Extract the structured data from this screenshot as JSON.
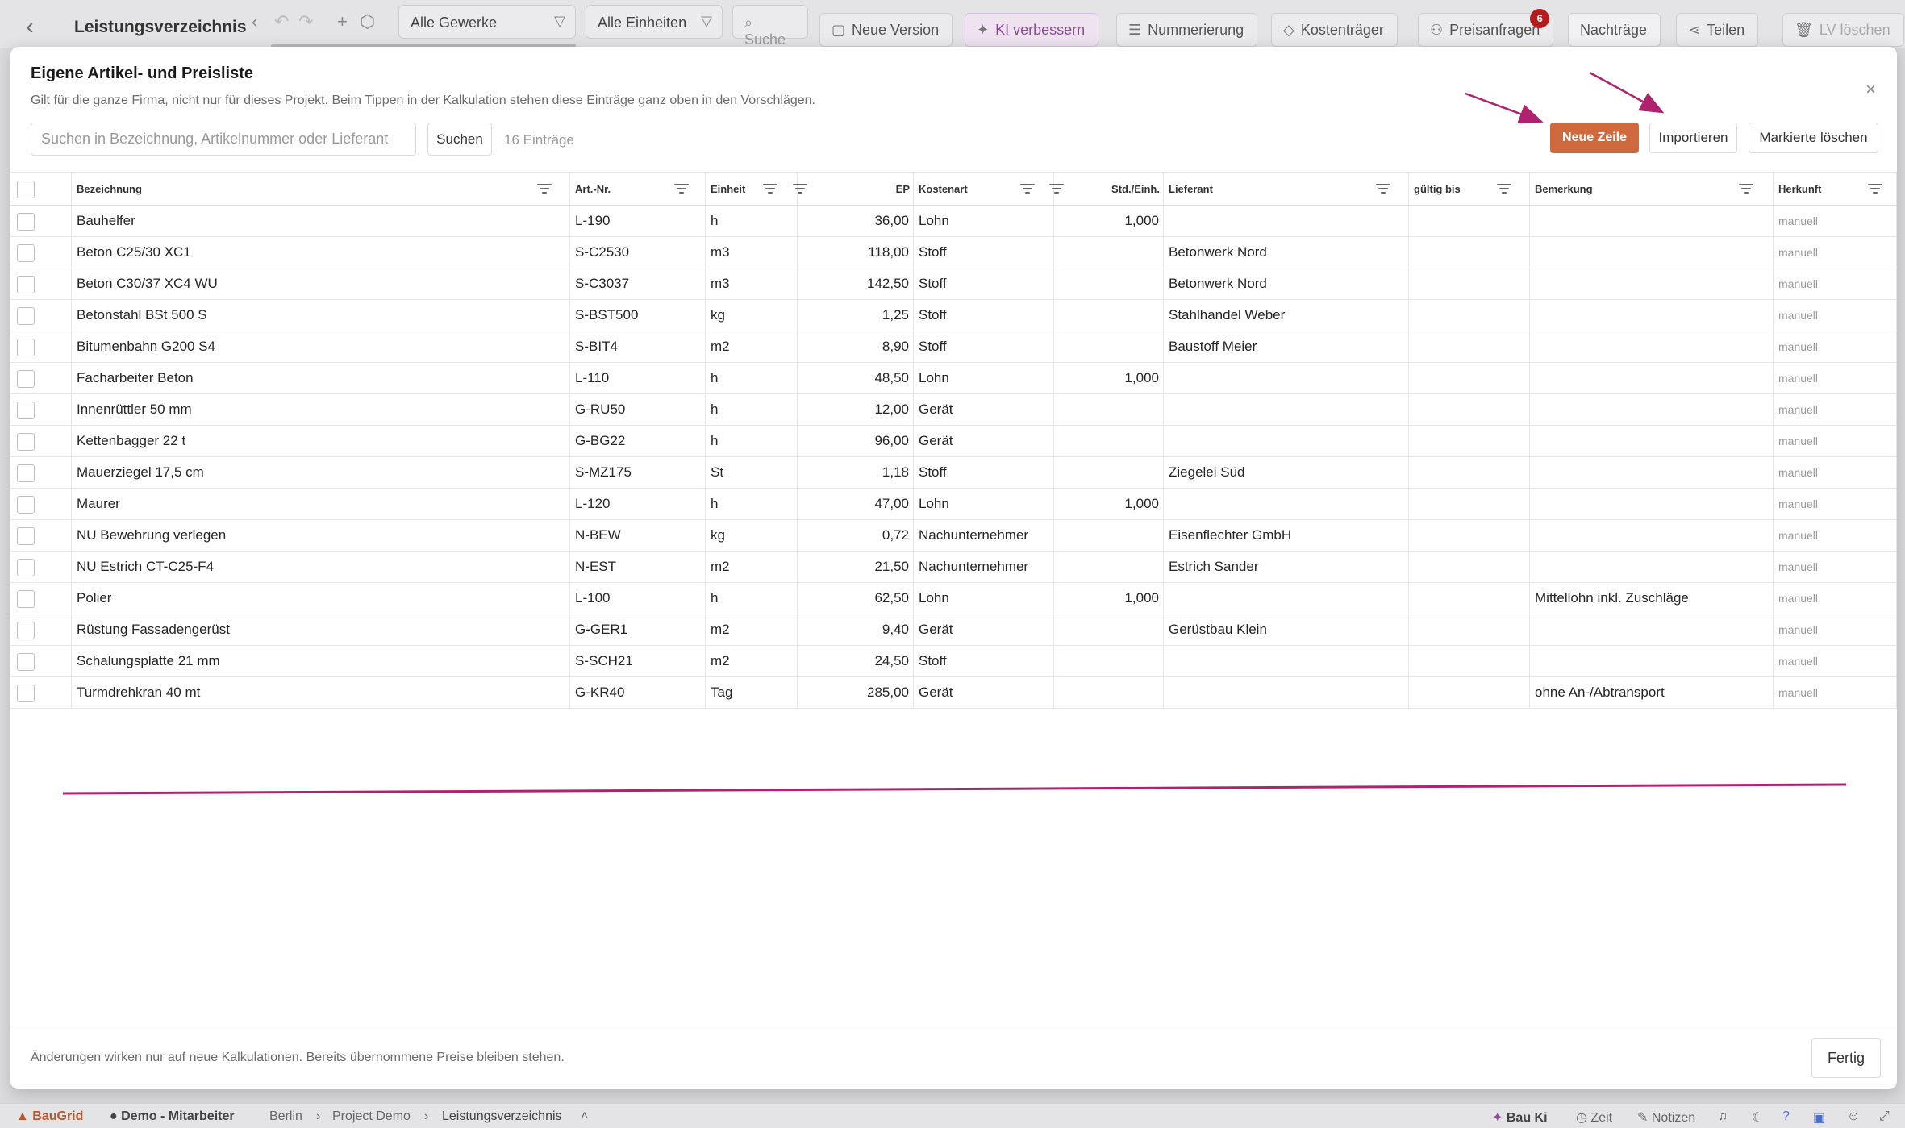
{
  "toolbar": {
    "title": "Leistungsverzeichnis",
    "trade_filter": "Alle Gewerke",
    "unit_filter": "Alle Einheiten",
    "search_placeholder": "Suche",
    "new_version": "Neue Version",
    "ki_improve": "KI verbessern",
    "numbering": "Nummerierung",
    "cost_bearer": "Kostenträger",
    "price_requests": "Preisanfragen",
    "price_requests_badge": "6",
    "supplements": "Nachträge",
    "share": "Teilen",
    "delete_lv": "LV löschen"
  },
  "modal": {
    "title": "Eigene Artikel- und Preisliste",
    "subtitle": "Gilt für die ganze Firma, nicht nur für dieses Projekt. Beim Tippen in der Kalkulation stehen diese Einträge ganz oben in den Vorschlägen.",
    "search_placeholder": "Suchen in Bezeichnung, Artikelnummer oder Lieferant",
    "search_button": "Suchen",
    "entry_count": "16 Einträge",
    "new_row": "Neue Zeile",
    "import": "Importieren",
    "delete_marked": "Markierte löschen",
    "close": "×",
    "footer_note": "Änderungen wirken nur auf neue Kalkulationen. Bereits übernommene Preise bleiben stehen.",
    "done": "Fertig"
  },
  "table": {
    "columns": [
      "Bezeichnung",
      "Art.-Nr.",
      "Einheit",
      "EP",
      "Kostenart",
      "Std./Einh.",
      "Lieferant",
      "gültig bis",
      "Bemerkung",
      "Herkunft"
    ],
    "rows": [
      [
        "Bauhelfer",
        "L-190",
        "h",
        "36,00",
        "Lohn",
        "1,000",
        "",
        "",
        "",
        "manuell"
      ],
      [
        "Beton C25/30 XC1",
        "S-C2530",
        "m3",
        "118,00",
        "Stoff",
        "",
        "Betonwerk Nord",
        "",
        "",
        "manuell"
      ],
      [
        "Beton C30/37 XC4 WU",
        "S-C3037",
        "m3",
        "142,50",
        "Stoff",
        "",
        "Betonwerk Nord",
        "",
        "",
        "manuell"
      ],
      [
        "Betonstahl BSt 500 S",
        "S-BST500",
        "kg",
        "1,25",
        "Stoff",
        "",
        "Stahlhandel Weber",
        "",
        "",
        "manuell"
      ],
      [
        "Bitumenbahn G200 S4",
        "S-BIT4",
        "m2",
        "8,90",
        "Stoff",
        "",
        "Baustoff Meier",
        "",
        "",
        "manuell"
      ],
      [
        "Facharbeiter Beton",
        "L-110",
        "h",
        "48,50",
        "Lohn",
        "1,000",
        "",
        "",
        "",
        "manuell"
      ],
      [
        "Innenrüttler 50 mm",
        "G-RU50",
        "h",
        "12,00",
        "Gerät",
        "",
        "",
        "",
        "",
        "manuell"
      ],
      [
        "Kettenbagger 22 t",
        "G-BG22",
        "h",
        "96,00",
        "Gerät",
        "",
        "",
        "",
        "",
        "manuell"
      ],
      [
        "Mauerziegel 17,5 cm",
        "S-MZ175",
        "St",
        "1,18",
        "Stoff",
        "",
        "Ziegelei Süd",
        "",
        "",
        "manuell"
      ],
      [
        "Maurer",
        "L-120",
        "h",
        "47,00",
        "Lohn",
        "1,000",
        "",
        "",
        "",
        "manuell"
      ],
      [
        "NU Bewehrung verlegen",
        "N-BEW",
        "kg",
        "0,72",
        "Nachunternehmer",
        "",
        "Eisenflechter GmbH",
        "",
        "",
        "manuell"
      ],
      [
        "NU Estrich CT-C25-F4",
        "N-EST",
        "m2",
        "21,50",
        "Nachunternehmer",
        "",
        "Estrich Sander",
        "",
        "",
        "manuell"
      ],
      [
        "Polier",
        "L-100",
        "h",
        "62,50",
        "Lohn",
        "1,000",
        "",
        "",
        "Mittellohn inkl. Zuschläge",
        "manuell"
      ],
      [
        "Rüstung Fassadengerüst",
        "G-GER1",
        "m2",
        "9,40",
        "Gerät",
        "",
        "Gerüstbau Klein",
        "",
        "",
        "manuell"
      ],
      [
        "Schalungsplatte 21 mm",
        "S-SCH21",
        "m2",
        "24,50",
        "Stoff",
        "",
        "",
        "",
        "",
        "manuell"
      ],
      [
        "Turmdrehkran 40 mt",
        "G-KR40",
        "Tag",
        "285,00",
        "Gerät",
        "",
        "",
        "",
        "ohne An-/Abtransport",
        "manuell"
      ]
    ]
  },
  "statusbar": {
    "brand": "BauGrid",
    "user": "Demo - Mitarbeiter",
    "crumb1": "Berlin",
    "crumb2": "Project Demo",
    "crumb3": "Leistungsverzeichnis",
    "bau_ki": "Bau Ki",
    "time": "Zeit",
    "notes": "Notizen"
  },
  "colors": {
    "primary_button": "#cf6a3f",
    "annotation": "#b0226e",
    "badge": "#b51c1c"
  },
  "icons": [
    "back-icon",
    "filter-icon",
    "search-icon",
    "close-icon",
    "arrow-annotation",
    "bell-icon",
    "moon-icon",
    "help-icon"
  ]
}
